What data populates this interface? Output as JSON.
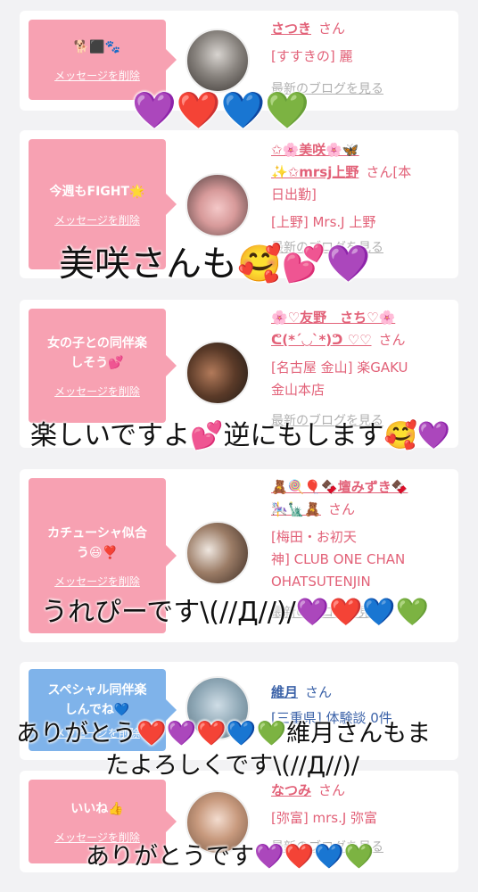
{
  "cards": [
    {
      "bubble": "🐕⬛🐾",
      "delete_label": "メッセージを削除",
      "name": "さつき",
      "san": "さん",
      "shop": "[すすきの] 麗",
      "blog": "最新のブログを見る"
    },
    {
      "bubble": "今週もFIGHT🌟",
      "delete_label": "メッセージを削除",
      "name_line1": "✩🌸美咲🌸🦋",
      "name_line2": "✨✩mrsj上野",
      "san": "さん[本",
      "san_line2": "日出勤]",
      "shop": "[上野] Mrs.J 上野",
      "blog": "最新のブログを見る"
    },
    {
      "bubble_line1": "女の子との同伴楽",
      "bubble_line2": "しそう💕",
      "delete_label": "メッセージを削除",
      "name_line1": "🌸♡友野　さち♡🌸",
      "name_line2": "ᕦ(*´◡`*)ᕤ ♡♡",
      "san": "さん",
      "shop_line1": "[名古屋 金山] 楽GAKU",
      "shop_line2": "金山本店",
      "blog": "最新のブログを見る"
    },
    {
      "bubble_line1": "カチューシャ似合",
      "bubble_line2": "う😃❣️",
      "delete_label": "メッセージを削除",
      "name_line1": "🧸🍭🎈🍫壇みずき🍫",
      "name_line2": "🎠🗽🧸",
      "san": "さん",
      "shop_line1": "[梅田・お初天",
      "shop_line2": "神] CLUB ONE CHAN",
      "shop_line3": "OHATSUTENJIN",
      "blog": "最新のブログを見る"
    },
    {
      "bubble_line1": "スペシャル同伴楽",
      "bubble_line2": "しんでね💙",
      "delete_label": "メッセージを削除",
      "name": "維月",
      "san": "さん",
      "shop": "[三重県] 体験談 0件"
    },
    {
      "bubble": "いいね👍",
      "delete_label": "メッセージを削除",
      "name": "なつみ",
      "san": "さん",
      "shop": "[弥富] mrs.J 弥富",
      "blog": "最新のブログを見る"
    }
  ],
  "overlays": {
    "o1": "💜❤️💙💚",
    "o2": "美咲さんも🥰💕💜",
    "o3": "楽しいですよ💕逆にもします🥰💜",
    "o4": "うれぴーです\\(//Д//)/💜❤️💙💚",
    "o5_line1": "ありがとう❤️💜❤️💙💚維月さんもま",
    "o5_line2": "たよろしくです\\(//Д//)/",
    "o6": "ありがとうです💜❤️💙💚"
  },
  "colors": {
    "pink_bubble": "#f7a1b2",
    "blue_bubble": "#7fb3ea",
    "pink_text": "#e26178",
    "blue_text": "#3b62a8"
  }
}
